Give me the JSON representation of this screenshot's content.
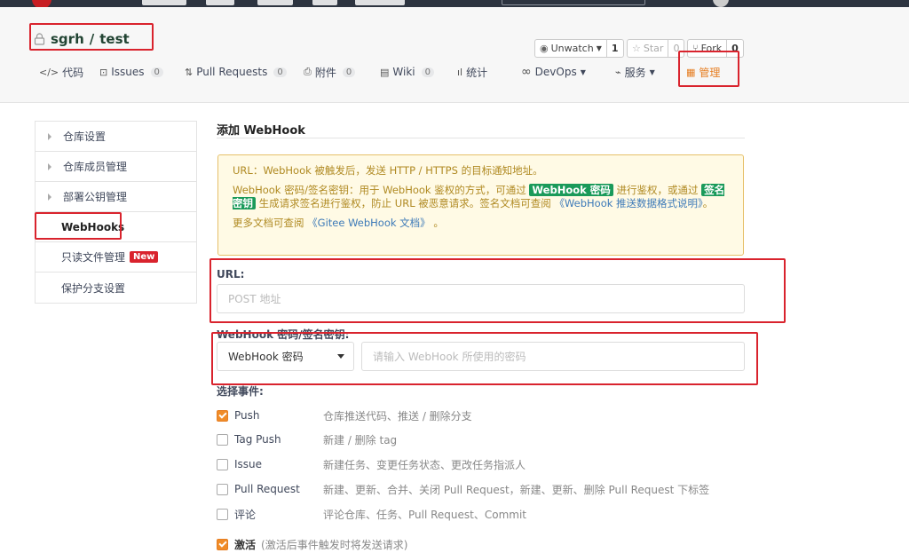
{
  "colors": {
    "accent": "#e67e22",
    "annotation": "#d9232d",
    "notice_bg": "#fffae5",
    "badge_green": "#1a9a5a"
  },
  "repo": {
    "owner": "sgrh",
    "separator": "/",
    "name": "test"
  },
  "actions": {
    "watch": {
      "label": "Unwatch",
      "count": "1"
    },
    "star": {
      "label": "Star",
      "count": "0"
    },
    "fork": {
      "label": "Fork",
      "count": "0"
    }
  },
  "tabs": [
    {
      "label": "代码",
      "icon": "code-icon"
    },
    {
      "label": "Issues",
      "count": "0",
      "icon": "issue-icon"
    },
    {
      "label": "Pull Requests",
      "count": "0",
      "icon": "pull-request-icon"
    },
    {
      "label": "附件",
      "count": "0",
      "icon": "attachment-icon"
    },
    {
      "label": "Wiki",
      "count": "0",
      "icon": "wiki-icon"
    },
    {
      "label": "统计",
      "icon": "chart-icon"
    },
    {
      "label": "DevOps",
      "icon": "infinity-icon"
    },
    {
      "label": "服务",
      "icon": "pulse-icon"
    },
    {
      "label": "管理",
      "icon": "manage-icon"
    }
  ],
  "sidebar": {
    "items": [
      {
        "label": "仓库设置"
      },
      {
        "label": "仓库成员管理"
      },
      {
        "label": "部署公钥管理"
      },
      {
        "label": "WebHooks"
      },
      {
        "label": "只读文件管理",
        "badge": "New"
      },
      {
        "label": "保护分支设置"
      }
    ]
  },
  "main": {
    "heading": "添加 WebHook",
    "notice": {
      "line1": "URL：WebHook 被触发后，发送 HTTP / HTTPS 的目标通知地址。",
      "line2_a": "WebHook 密码/签名密钥：用于 WebHook 鉴权的方式，可通过",
      "line2_tag1": "WebHook 密码",
      "line2_b": "进行鉴权，或通过",
      "line2_tag2": "签名密钥",
      "line2_c": "生成请求签名进行鉴权，防止 URL 被恶意请求。签名文档可查阅",
      "line2_link": "《WebHook 推送数据格式说明》",
      "line2_end": "。",
      "line3_a": "更多文档可查阅",
      "line3_link": "《Gitee WebHook 文档》",
      "line3_end": "。"
    },
    "url_label": "URL:",
    "url_placeholder": "POST 地址",
    "secret_label": "WebHook 密码/签名密钥:",
    "secret_type": "WebHook 密码",
    "secret_placeholder": "请输入 WebHook 所使用的密码",
    "events_label": "选择事件:",
    "events": [
      {
        "name": "Push",
        "desc": "仓库推送代码、推送 / 删除分支",
        "checked": true
      },
      {
        "name": "Tag Push",
        "desc": "新建 / 删除 tag",
        "checked": false
      },
      {
        "name": "Issue",
        "desc": "新建任务、变更任务状态、更改任务指派人",
        "checked": false
      },
      {
        "name": "Pull Request",
        "desc": "新建、更新、合并、关闭 Pull Request，新建、更新、删除 Pull Request 下标签",
        "checked": false
      },
      {
        "name": "评论",
        "desc": "评论仓库、任务、Pull Request、Commit",
        "checked": false
      }
    ],
    "activate": {
      "label": "激活",
      "hint": "(激活后事件触发时将发送请求)",
      "checked": true
    }
  }
}
